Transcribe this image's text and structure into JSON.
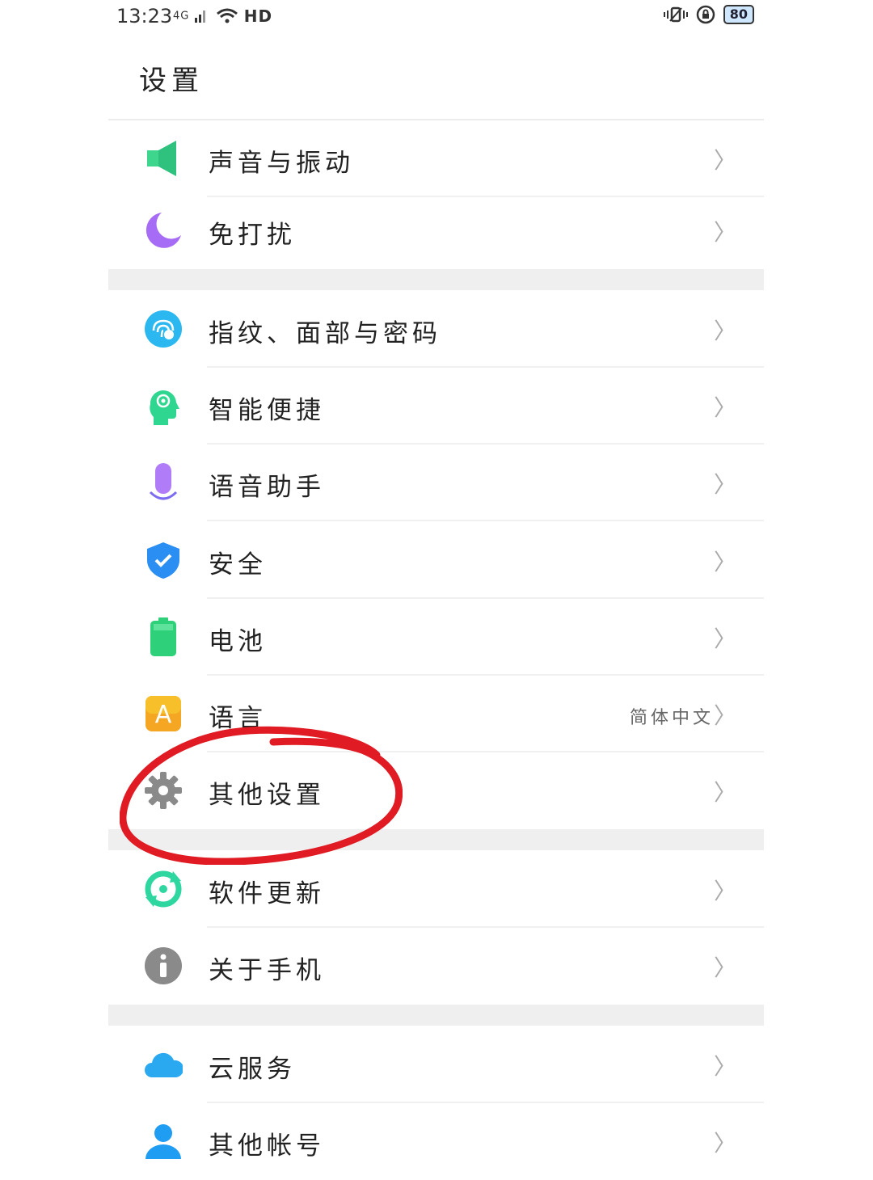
{
  "status_bar": {
    "time": "13:23",
    "signal_label": "4G",
    "hd_label": "HD",
    "battery_level": "80"
  },
  "page": {
    "title": "设置"
  },
  "sections": [
    {
      "items": [
        {
          "label": "声音与振动",
          "icon": "speaker-icon"
        },
        {
          "label": "免打扰",
          "icon": "moon-icon"
        }
      ]
    },
    {
      "items": [
        {
          "label": "指纹、面部与密码",
          "icon": "fingerprint-icon"
        },
        {
          "label": "智能便捷",
          "icon": "smart-head-icon"
        },
        {
          "label": "语音助手",
          "icon": "microphone-icon"
        },
        {
          "label": "安全",
          "icon": "shield-icon"
        },
        {
          "label": "电池",
          "icon": "battery-icon"
        },
        {
          "label": "语言",
          "value": "简体中文",
          "icon": "language-icon"
        },
        {
          "label": "其他设置",
          "icon": "gear-icon"
        }
      ]
    },
    {
      "items": [
        {
          "label": "软件更新",
          "icon": "update-icon"
        },
        {
          "label": "关于手机",
          "icon": "info-icon"
        }
      ]
    },
    {
      "items": [
        {
          "label": "云服务",
          "icon": "cloud-icon"
        },
        {
          "label": "其他帐号",
          "icon": "account-icon"
        }
      ]
    }
  ],
  "chevron": "〉",
  "colors": {
    "annotation": "#e01b24",
    "divider": "#efefef"
  }
}
